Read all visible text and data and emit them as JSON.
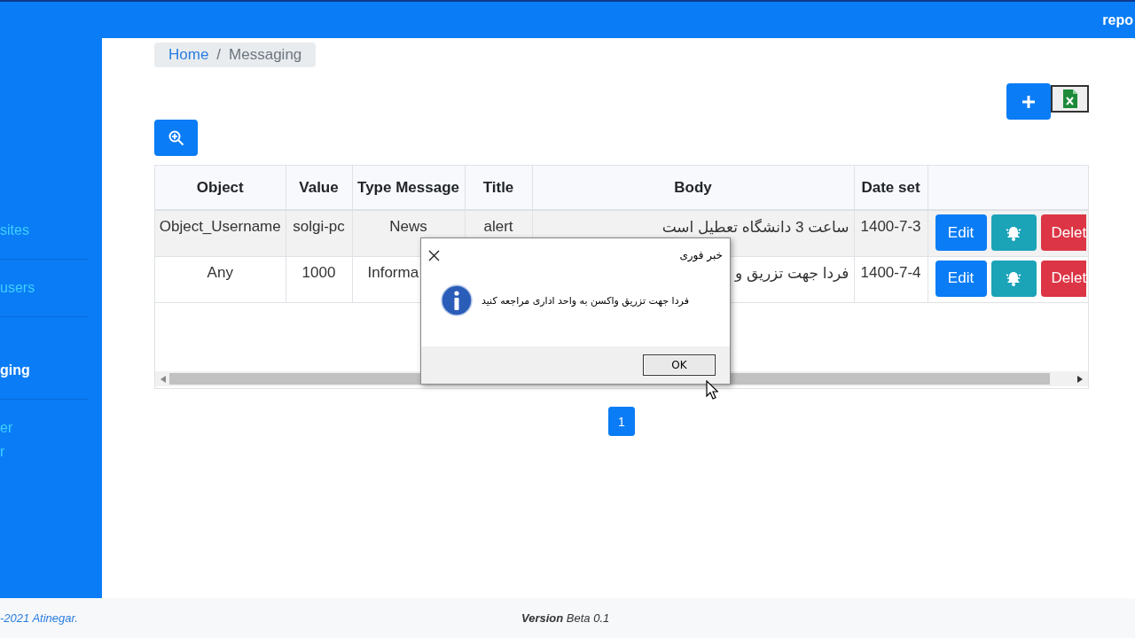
{
  "header": {
    "text": "repo"
  },
  "sidebar": {
    "items": [
      {
        "label": "sites",
        "selected": false
      },
      {
        "label": "users",
        "selected": false
      },
      {
        "label": "ging",
        "selected": true
      },
      {
        "label": "er\nr",
        "selected": false
      }
    ]
  },
  "breadcrumb": {
    "items": [
      {
        "label": "Home",
        "kind": "link"
      },
      {
        "label": "Messaging",
        "kind": "current"
      }
    ],
    "separator": "/"
  },
  "table": {
    "columns": [
      "Object",
      "Value",
      "Type Message",
      "Title",
      "Body",
      "Date set"
    ],
    "rows": [
      {
        "object": "Object_Username",
        "value": "solgi-pc",
        "type_message": "News",
        "title": "alert",
        "body": "ساعت 3 دانشگاه تعطیل است",
        "date_set": "1400-7-3",
        "edit": "Edit",
        "delete": "Delet"
      },
      {
        "object": "Any",
        "value": "1000",
        "type_message": "Informa",
        "body": "فردا جهت تزریق و",
        "date_set": "1400-7-4",
        "edit": "Edit",
        "delete": "Delet"
      }
    ]
  },
  "pagination": [
    {
      "label": "1",
      "selected": true
    }
  ],
  "dialog": {
    "title": "خبر فوری",
    "message": "فردا جهت تزریق واکسن به واحد اداری مراجعه کنید",
    "button": "OK"
  },
  "footer": {
    "copyright": "-2021 Atinegar.",
    "version": "**Version** Beta 0.1"
  }
}
